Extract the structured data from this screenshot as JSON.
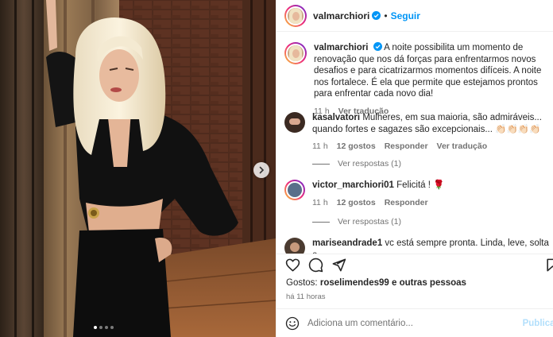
{
  "post": {
    "username": "valmarchiori",
    "verified": true,
    "separator": "•",
    "follow_label": "Seguir",
    "caption": "A noite possibilita um momento de renovação que nos dá forças para enfrentarmos novos desafios e para cicatrizarmos momentos difíceis. A noite nos fortalece. É ela que permite que estejamos prontos para enfrentar cada novo dia!",
    "caption_time": "11 h",
    "see_translation": "Ver tradução",
    "carousel": {
      "slides": 4,
      "active_slide": 1
    }
  },
  "comments": [
    {
      "username": "kasalvatori",
      "text": "Mulheres, em sua maioria, são admiráveis... quando fortes e sagazes são excepcionais... 👏🏻👏🏻👏🏻👏🏻",
      "time": "11 h",
      "likes": "12 gostos",
      "reply": "Responder",
      "translate": "Ver tradução",
      "view_replies": "Ver respostas (1)"
    },
    {
      "username": "victor_marchiori01",
      "text": "Felicitá ! 🌹",
      "time": "11 h",
      "likes": "12 gostos",
      "reply": "Responder",
      "view_replies": "Ver respostas (1)"
    },
    {
      "username": "mariseandrade1",
      "text": "vc está sempre pronta. Linda, leve, solta e"
    }
  ],
  "likes": {
    "prefix": "Gostos:",
    "user": "roselimendes99",
    "suffix": "e outras pessoas"
  },
  "timestamp": "há 11 horas",
  "add_comment": {
    "placeholder": "Adiciona um comentário...",
    "publish_label": "Publicar"
  },
  "colors": {
    "accent": "#0095f6",
    "publish_disabled": "#b2dffc",
    "secondary_text": "#737373"
  },
  "icons": [
    "heart-icon",
    "comment-icon",
    "share-icon",
    "bookmark-icon",
    "emoji-icon",
    "verified-badge-icon",
    "chevron-right-icon"
  ]
}
